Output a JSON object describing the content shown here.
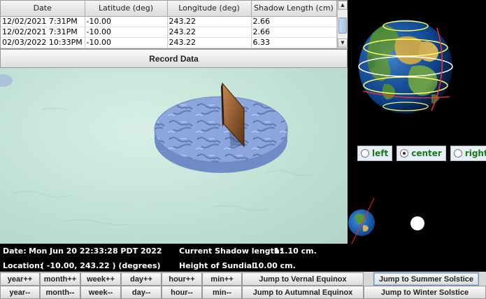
{
  "table": {
    "headers": [
      "Date",
      "Latitude (deg)",
      "Longitude (deg)",
      "Shadow Length (cm)"
    ],
    "rows": [
      [
        "12/02/2021 7:31PM",
        "-10.00",
        "243.22",
        "2.66"
      ],
      [
        "12/02/2021 7:31PM",
        "-10.00",
        "243.22",
        "2.66"
      ],
      [
        "02/03/2022 10:33PM",
        "-10.00",
        "243.22",
        "6.33"
      ]
    ]
  },
  "record_label": "Record Data",
  "view": {
    "options": [
      "left",
      "center",
      "right"
    ],
    "selected": "center"
  },
  "status": {
    "date_label": "Date:",
    "date_value": "Mon Jun 20 22:33:28 PDT 2022",
    "shadow_label": "Current Shadow length:",
    "shadow_value": "11.10 cm.",
    "location_label": "Location:",
    "location_value": "( -10.00, 243.22 ) (degrees)",
    "height_label": "Height of Sundial:",
    "height_value": "10.00 cm."
  },
  "controls": {
    "row1": [
      "year++",
      "month++",
      "week++",
      "day++",
      "hour++",
      "min++"
    ],
    "row2": [
      "year--",
      "month--",
      "week--",
      "day--",
      "hour--",
      "min--"
    ],
    "jump_vernal": "Jump to Vernal Equinox",
    "jump_summer": "Jump to Summer Solstice",
    "jump_autumnal": "Jump to Autumnal Equinox",
    "jump_winter": "Jump to Winter Solstice"
  },
  "icons": {
    "scroll_up": "scroll-up-arrow-icon",
    "scroll_down": "scroll-down-arrow-icon",
    "globe": "earth-globe-icon",
    "small_earth": "orbit-earth-icon",
    "sun": "sun-icon"
  },
  "colors": {
    "view_label": "#1a7a1a",
    "background": "#000000"
  }
}
